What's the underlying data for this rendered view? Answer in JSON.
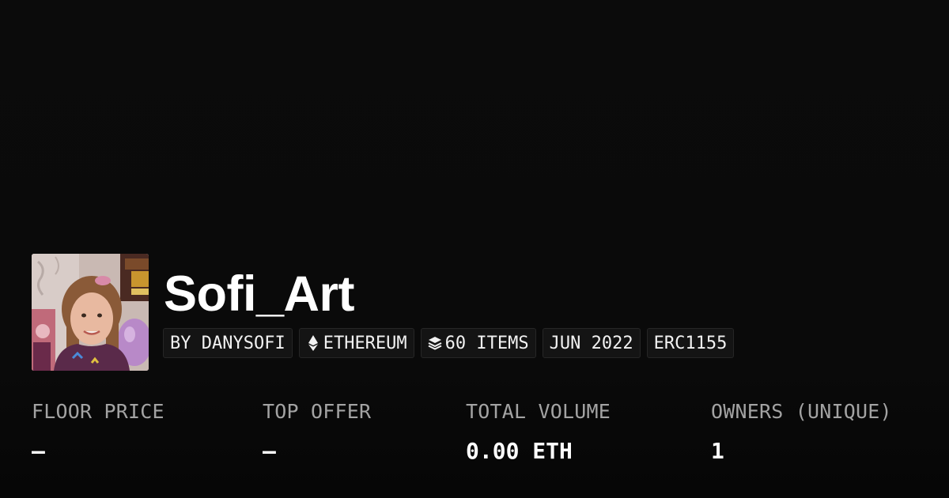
{
  "collection": {
    "name": "Sofi_Art",
    "avatar_icon": "collection-avatar-photo"
  },
  "chips": [
    {
      "label": "BY DANYSOFI",
      "icon": null
    },
    {
      "label": "ETHEREUM",
      "icon": "ethereum-icon"
    },
    {
      "label": "60 ITEMS",
      "icon": "layers-icon"
    },
    {
      "label": "JUN 2022",
      "icon": null
    },
    {
      "label": "ERC1155",
      "icon": null
    }
  ],
  "stats": [
    {
      "label": "FLOOR PRICE",
      "value": "–"
    },
    {
      "label": "TOP OFFER",
      "value": "–"
    },
    {
      "label": "TOTAL VOLUME",
      "value": "0.00 ETH"
    },
    {
      "label": "OWNERS (UNIQUE)",
      "value": "1"
    }
  ],
  "colors": {
    "background": "#0a0a0a",
    "chip_background": "#141414",
    "chip_border": "#262626",
    "label_gray": "#a3a3a3",
    "text_white": "#ffffff"
  }
}
